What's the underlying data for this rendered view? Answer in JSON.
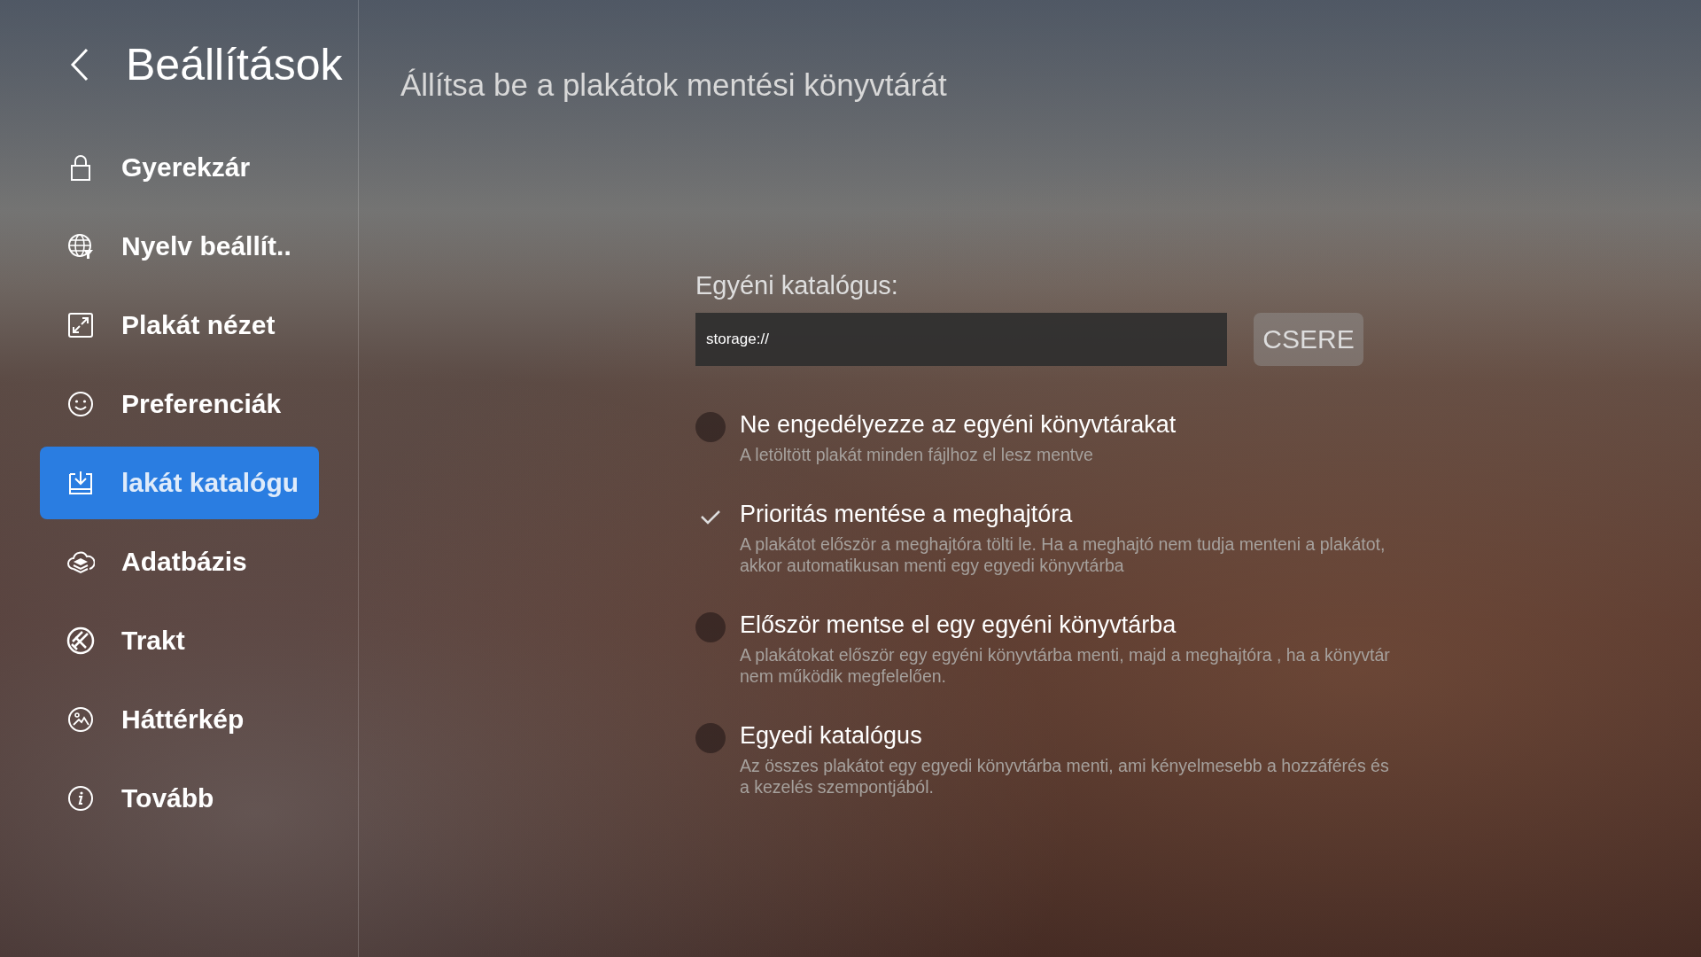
{
  "sidebar": {
    "title": "Beállítások",
    "items": [
      {
        "label": "Gyerekzár",
        "selected": false
      },
      {
        "label": "Nyelv beállít..",
        "selected": false
      },
      {
        "label": "Plakát nézet",
        "selected": false
      },
      {
        "label": "Preferenciák",
        "selected": false
      },
      {
        "label": "lakát katalógu",
        "selected": true
      },
      {
        "label": "Adatbázis",
        "selected": false
      },
      {
        "label": "Trakt",
        "selected": false
      },
      {
        "label": "Háttérkép",
        "selected": false
      },
      {
        "label": "Tovább",
        "selected": false
      }
    ]
  },
  "main": {
    "heading": "Állítsa be a plakátok mentési könyvtárát",
    "field_label": "Egyéni katalógus:",
    "path_field": {
      "value": "storage://"
    },
    "change_button": "CSERE",
    "options": [
      {
        "title": "Ne engedélyezze az egyéni könyvtárakat",
        "description": "A letöltött plakát minden fájlhoz el lesz mentve",
        "selected": false
      },
      {
        "title": "Prioritás mentése a meghajtóra",
        "description": "A plakátot először a meghajtóra tölti le. Ha a meghajtó nem tudja menteni a plakátot, akkor automatikusan menti egy egyedi könyvtárba",
        "selected": true
      },
      {
        "title": "Először mentse el egy egyéni könyvtárba",
        "description": "A plakátokat először egy egyéni könyvtárba menti, majd a meghajtóra , ha a könyvtár nem működik megfelelően.",
        "selected": false
      },
      {
        "title": "Egyedi katalógus",
        "description": "Az összes plakátot egy egyedi könyvtárba menti, ami kényelmesebb a hozzáférés és a kezelés szempontjából.",
        "selected": false
      }
    ]
  }
}
